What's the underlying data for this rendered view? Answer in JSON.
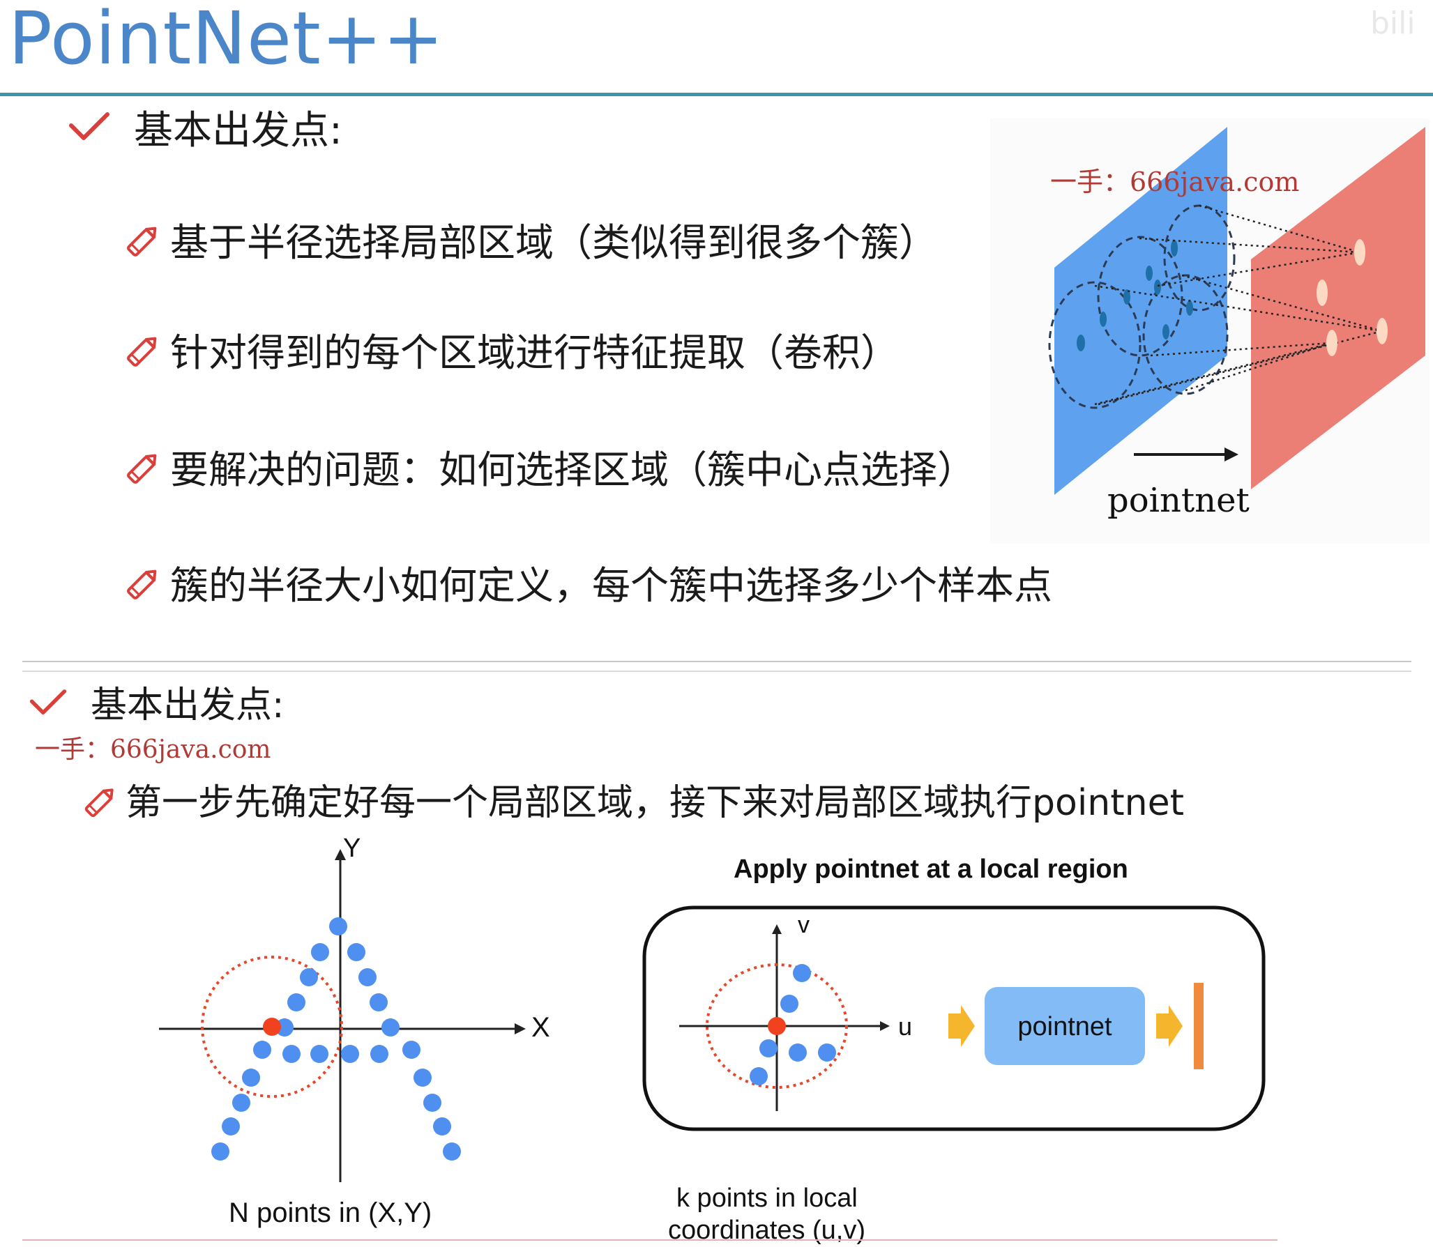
{
  "slide": {
    "title": "PointNet++",
    "corner_mark": "bili"
  },
  "top_section": {
    "heading": "基本出发点:",
    "bullets": [
      {
        "text": "基于半径选择局部区域（类似得到很多个簇）"
      },
      {
        "text": "针对得到的每个区域进行特征提取（卷积）"
      },
      {
        "text": "要解决的问题：如何选择区域（簇中心点选择）"
      },
      {
        "text": "簇的半径大小如何定义，每个簇中选择多少个样本点"
      }
    ],
    "figure": {
      "watermark": "一手：666java.com",
      "label": "pointnet",
      "left_plane_color": "#5ea2ef",
      "right_plane_color": "#eb7f76"
    }
  },
  "bottom_section": {
    "heading": "基本出发点:",
    "watermark": "一手：666java.com",
    "bullet": "第一步先确定好每一个局部区域，接下来对局部区域执行pointnet",
    "left_figure": {
      "y_axis_label": "Y",
      "x_axis_label": "X",
      "caption": "N points in (X,Y)",
      "point_color": "#4f8ff0",
      "center_color": "#f0421e"
    },
    "right_figure": {
      "title": "Apply pointnet at a local region",
      "v_axis_label": "v",
      "u_axis_label": "u",
      "box_label": "pointnet",
      "caption_line1": "k points in local",
      "caption_line2": "coordinates (u,v)",
      "arrow_color": "#f5b52c",
      "box_color": "#82bbf5",
      "output_bar_color": "#f08a3c"
    }
  }
}
